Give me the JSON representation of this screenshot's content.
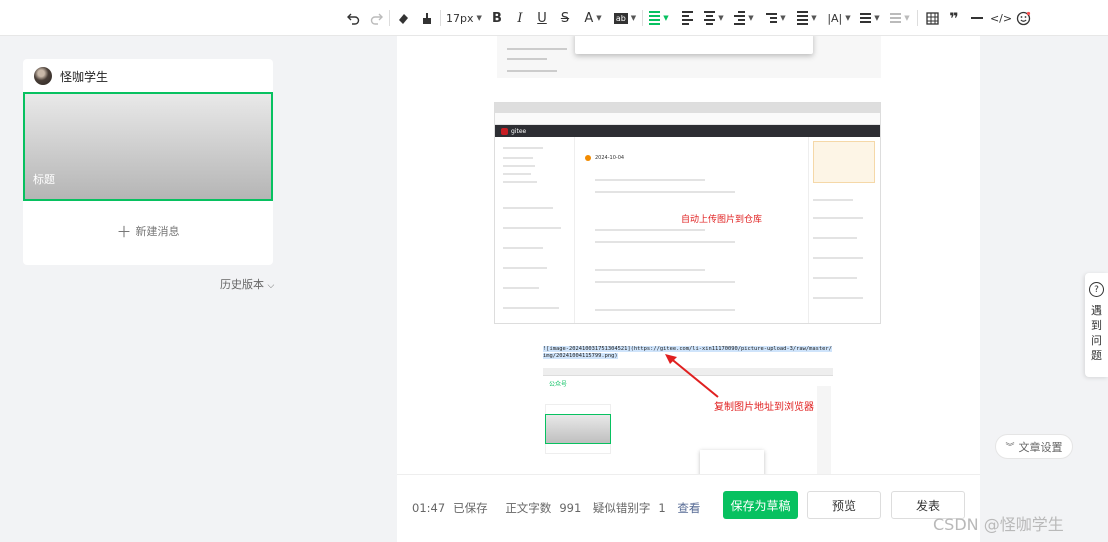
{
  "toolbar": {
    "font_size": "17px",
    "items": [
      "undo-icon",
      "redo-icon",
      "clear-format-icon",
      "format-painter-icon",
      "font-size",
      "bold",
      "italic",
      "underline",
      "strikethrough",
      "font-color",
      "background-color",
      "align-justify",
      "align-left",
      "align-center",
      "align-right",
      "indent",
      "line-height",
      "letter-spacing",
      "bullet-list",
      "ordered-list",
      "table",
      "quote",
      "divider",
      "code",
      "emoji"
    ]
  },
  "left_panel": {
    "author": "怪咖学生",
    "cover_title": "标题",
    "new_message": "新建消息",
    "history": "历史版本"
  },
  "editor": {
    "shot2_caption": "自动上传图片到仓库",
    "shot2_app": "gitee",
    "shot2_date": "2024-10-04",
    "shot3_code_plain": "![image-20241003175",
    "shot3_code_hl": "1304521](https://gitee.com/li-xin11170090/picture-upload-3/raw/master/img/20241004115799.png)",
    "shot3_caption": "复制图片地址到浏览器",
    "shot3_brand": "公众号"
  },
  "bottom": {
    "time": "01:47",
    "saved": "已保存",
    "word_count_label": "正文字数",
    "word_count": "991",
    "typo_label": "疑似错别字",
    "typo_count": "1",
    "check": "查看",
    "save_draft": "保存为草稿",
    "preview": "预览",
    "publish": "发表"
  },
  "help": {
    "text": "遇到问题"
  },
  "article_settings": "文章设置",
  "watermark": "CSDN @怪咖学生",
  "colors": {
    "brand_green": "#07c160",
    "annotation_red": "#e02020",
    "link_blue": "#576b95"
  }
}
